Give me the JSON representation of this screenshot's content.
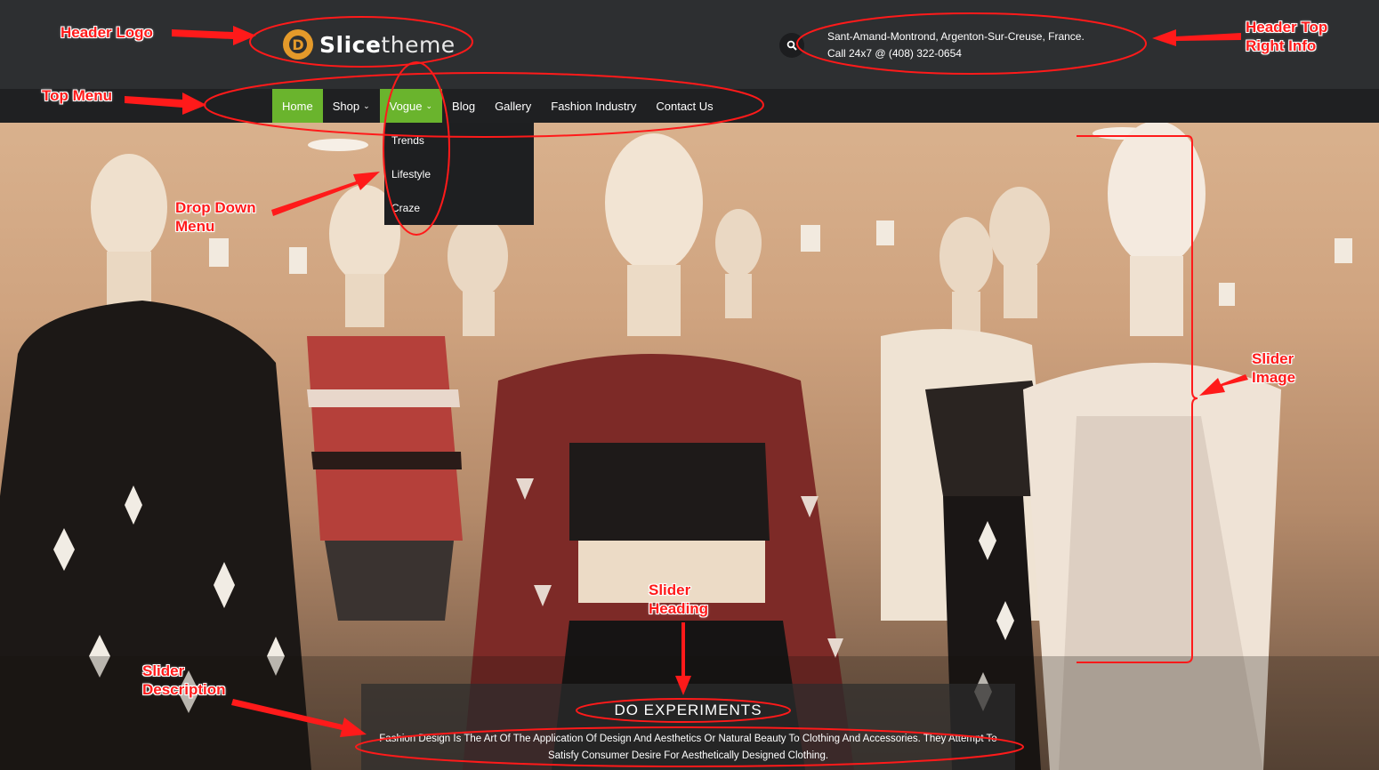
{
  "header": {
    "logo": {
      "mark": "D",
      "bold": "Slice",
      "light": "theme"
    },
    "info_line1": "Sant-Amand-Montrond, Argenton-Sur-Creuse, France.",
    "info_line2": "Call 24x7 @ (408) 322-0654"
  },
  "nav": {
    "items": [
      {
        "label": "Home",
        "active": true
      },
      {
        "label": "Shop",
        "has_caret": true
      },
      {
        "label": "Vogue",
        "has_caret": true,
        "open": true
      },
      {
        "label": "Blog"
      },
      {
        "label": "Gallery"
      },
      {
        "label": "Fashion Industry"
      },
      {
        "label": "Contact Us"
      }
    ],
    "caret": "⌄",
    "dropdown": [
      "Trends",
      "Lifestyle",
      "Craze"
    ]
  },
  "slider": {
    "heading": "DO EXPERIMENTS",
    "description": "Fashion Design Is The Art Of The Application Of Design And Aesthetics Or Natural Beauty To Clothing And Accessories. They Attempt To Satisfy Consumer Desire For Aesthetically Designed Clothing."
  },
  "annotations": {
    "header_logo": "Header Logo",
    "top_menu": "Top Menu",
    "drop_down": "Drop Down Menu",
    "header_info": "Header Top Right Info",
    "slider_image": "Slider Image",
    "slider_heading": "Slider Heading",
    "slider_description": "Slider Description"
  },
  "colors": {
    "accent_green": "#6ab42d",
    "header_bg": "#2d2f31",
    "annotation_red": "#ff1a1a",
    "logo_orange": "#e49a2a"
  },
  "icons": [
    "search-icon",
    "logo-icon",
    "chevron-down-icon"
  ]
}
